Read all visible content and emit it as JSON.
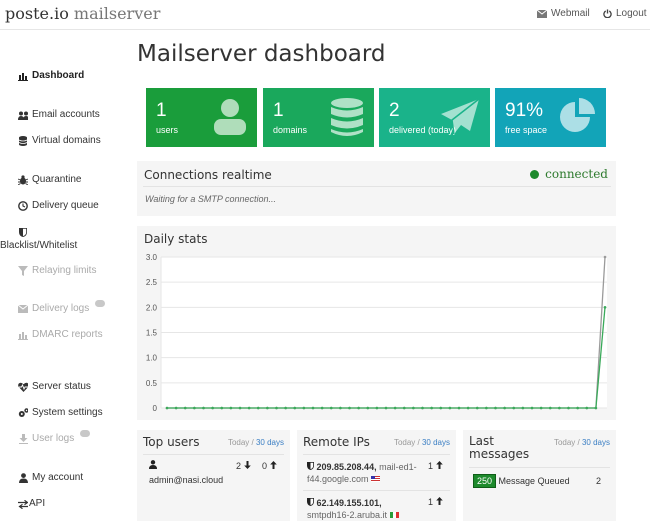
{
  "brand": {
    "part1": "poste.io",
    "part2": "mailserver"
  },
  "topnav": {
    "webmail": "Webmail",
    "logout": "Logout"
  },
  "sidebar": {
    "dashboard": "Dashboard",
    "email_accounts": "Email accounts",
    "virtual_domains": "Virtual domains",
    "quarantine": "Quarantine",
    "delivery_queue": "Delivery queue",
    "blacklist": "Blacklist/Whitelist",
    "relaying_limits": "Relaying limits",
    "delivery_logs": "Delivery logs",
    "dmarc_reports": "DMARC reports",
    "server_status": "Server status",
    "system_settings": "System settings",
    "user_logs": "User logs",
    "my_account": "My account",
    "api": "API"
  },
  "page_title": "Mailserver dashboard",
  "tiles": [
    {
      "num": "1",
      "label": "users",
      "color": "#1a9d3b"
    },
    {
      "num": "1",
      "label": "domains",
      "color": "#1aa85c"
    },
    {
      "num": "2",
      "label": "delivered (today)",
      "color": "#1ab38a"
    },
    {
      "num": "91%",
      "label": "free space",
      "color": "#12a4b8"
    }
  ],
  "connections": {
    "title": "Connections realtime",
    "status": "connected",
    "waiting": "Waiting for a SMTP connection..."
  },
  "chart_data": {
    "type": "line",
    "title": "Daily stats",
    "ylim": [
      0,
      3
    ],
    "yticks": [
      "3.0",
      "2.5",
      "2.0",
      "1.5",
      "1.0",
      "0.5",
      "0"
    ],
    "series": [
      {
        "color": "#9a9a9a",
        "values": [
          0,
          0,
          0,
          0,
          0,
          0,
          0,
          0,
          0,
          0,
          0,
          0,
          0,
          0,
          0,
          0,
          0,
          0,
          0,
          0,
          0,
          0,
          0,
          0,
          0,
          0,
          0,
          0,
          0,
          0,
          0,
          0,
          0,
          0,
          0,
          0,
          0,
          0,
          0,
          0,
          0,
          0,
          0,
          0,
          0,
          0,
          0,
          0,
          3
        ]
      },
      {
        "color": "#3aaa5a",
        "values": [
          0,
          0,
          0,
          0,
          0,
          0,
          0,
          0,
          0,
          0,
          0,
          0,
          0,
          0,
          0,
          0,
          0,
          0,
          0,
          0,
          0,
          0,
          0,
          0,
          0,
          0,
          0,
          0,
          0,
          0,
          0,
          0,
          0,
          0,
          0,
          0,
          0,
          0,
          0,
          0,
          0,
          0,
          0,
          0,
          0,
          0,
          0,
          0,
          2
        ]
      }
    ]
  },
  "top_users": {
    "title": "Top users",
    "today": "Today",
    "sep": " / ",
    "days": "30 days",
    "user": "admin@nasi.cloud",
    "down": "2",
    "up": "0"
  },
  "remote_ips": {
    "title": "Remote IPs",
    "today": "Today",
    "sep": " / ",
    "days": "30 days",
    "items": [
      {
        "ip": "209.85.208.44,",
        "host1": "mail-ed1-",
        "host2": "f44.google.com",
        "count": "1"
      },
      {
        "ip": "62.149.155.101,",
        "host1": "",
        "host2": "smtpdh16-2.aruba.it",
        "count": "1"
      }
    ]
  },
  "last_messages": {
    "title1": "Last",
    "title2": "messages",
    "today": "Today",
    "sep": " / ",
    "days": "30 days",
    "badge": "250",
    "text": "Message Queued",
    "count": "2"
  }
}
